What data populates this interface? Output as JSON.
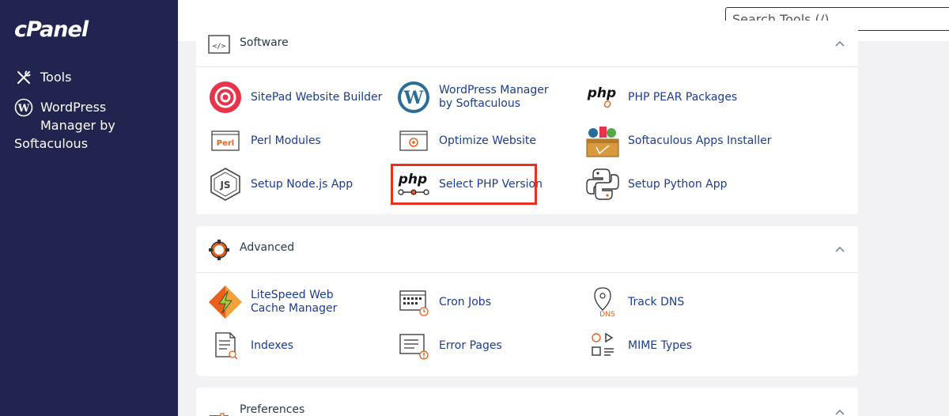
{
  "sidebar": {
    "logo": "cPanel",
    "items": [
      {
        "label": "Tools",
        "icon": "tools-icon"
      },
      {
        "label_line1": "WordPress",
        "label_line2": "Manager by",
        "label_line3": "Softaculous",
        "icon": "wordpress-icon"
      }
    ]
  },
  "search": {
    "placeholder": "Search Tools (/)"
  },
  "panels": {
    "software": {
      "title": "Software",
      "items": [
        {
          "label": "SitePad Website Builder"
        },
        {
          "label": "WordPress Manager by Softaculous"
        },
        {
          "label": "PHP PEAR Packages"
        },
        {
          "label": "Perl Modules"
        },
        {
          "label": "Optimize Website"
        },
        {
          "label": "Softaculous Apps Installer"
        },
        {
          "label": "Setup Node.js App"
        },
        {
          "label": "Select PHP Version"
        },
        {
          "label": "Setup Python App"
        }
      ]
    },
    "advanced": {
      "title": "Advanced",
      "items": [
        {
          "label": "LiteSpeed Web Cache Manager"
        },
        {
          "label": "Cron Jobs"
        },
        {
          "label": "Track DNS"
        },
        {
          "label": "Indexes"
        },
        {
          "label": "Error Pages"
        },
        {
          "label": "MIME Types"
        }
      ]
    },
    "preferences": {
      "title": "Preferences"
    }
  },
  "icon_text": {
    "php": "php",
    "perl": "Perl",
    "dns": "DNS",
    "code": "</>"
  },
  "colors": {
    "sidebar_bg": "#20244f",
    "link": "#1c3c8c",
    "accent_orange": "#e8601c",
    "highlight": "#e8321f"
  }
}
